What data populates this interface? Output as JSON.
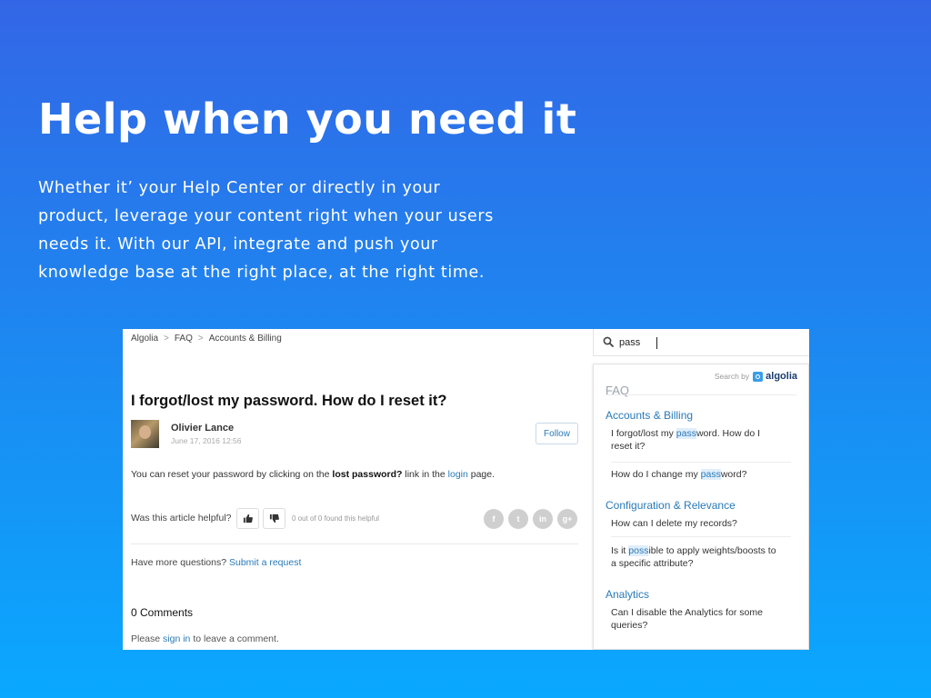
{
  "hero": {
    "title": "Help when you need it",
    "description": "Whether it’ your Help Center or directly in your product, leverage your content right when your users needs it. With our API, integrate and push your knowledge base at the right place, at the right time."
  },
  "article": {
    "breadcrumb": [
      "Algolia",
      "FAQ",
      "Accounts & Billing"
    ],
    "breadcrumb_sep": ">",
    "title": "I forgot/lost my password. How do I reset it?",
    "author": "Olivier Lance",
    "date": "June 17, 2016 12:56",
    "follow_label": "Follow",
    "body_prefix": "You can reset your password by clicking on the",
    "body_bold": "lost password?",
    "body_mid": "link in the",
    "body_link": "login",
    "body_suffix": "page.",
    "helpful_label": "Was this article helpful?",
    "vote_count": "0 out of 0 found this helpful",
    "share": [
      "f",
      "t",
      "in",
      "g+"
    ],
    "more_questions_label": "Have more questions?",
    "submit_request_link": "Submit a request",
    "comments_title": "0 Comments",
    "sign_in_prefix": "Please",
    "sign_in_link": "sign in",
    "sign_in_suffix": "to leave a comment."
  },
  "search": {
    "query": "pass",
    "powered_by": "Search by",
    "provider": "algolia",
    "section": "FAQ",
    "categories": [
      {
        "name": "Accounts & Billing",
        "hits": [
          {
            "before": "I forgot/lost my ",
            "match": "pass",
            "after": "word. How do I reset it?"
          },
          {
            "before": "How do I change my ",
            "match": "pass",
            "after": "word?"
          }
        ]
      },
      {
        "name": "Configuration & Relevance",
        "hits": [
          {
            "before": "How can I delete my records?",
            "match": "",
            "after": ""
          },
          {
            "before": "Is it ",
            "match": "poss",
            "after": "ible to apply weights/boosts to a specific attribute?"
          }
        ]
      },
      {
        "name": "Analytics",
        "hits": [
          {
            "before": "Can I disable the Analytics for some queries?",
            "match": "",
            "after": ""
          }
        ]
      }
    ]
  },
  "colors": {
    "gradient_top": "#3366e6",
    "gradient_bottom": "#0aa8ff",
    "link": "#2a7ab8",
    "highlight": "#e0eefb"
  }
}
